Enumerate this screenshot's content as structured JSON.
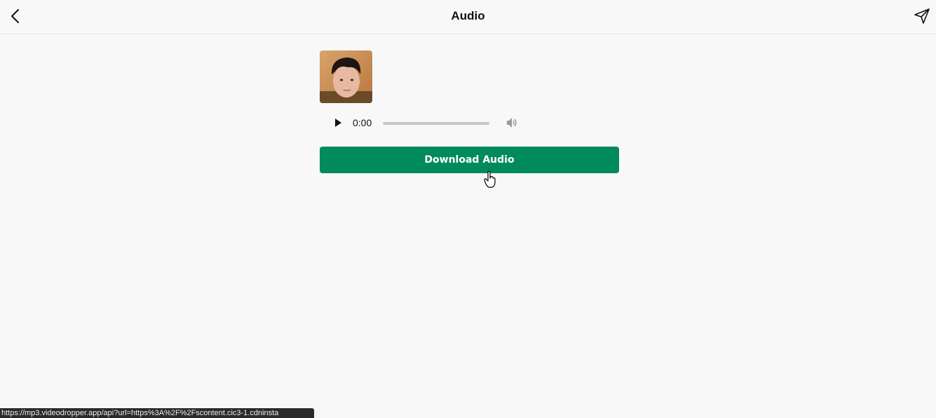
{
  "header": {
    "title": "Audio",
    "back_icon": "chevron-left-icon",
    "share_icon": "send-icon"
  },
  "player": {
    "current_time": "0:00",
    "progress": 0,
    "play_icon": "play-icon",
    "volume_icon": "volume-icon"
  },
  "actions": {
    "download_label": "Download Audio"
  },
  "status_bar": {
    "url": "https://mp3.videodropper.app/api?url=https%3A%2F%2Fscontent.cic3-1.cdninsta"
  },
  "colors": {
    "accent": "#008a5e",
    "background": "#f8f8f8"
  }
}
